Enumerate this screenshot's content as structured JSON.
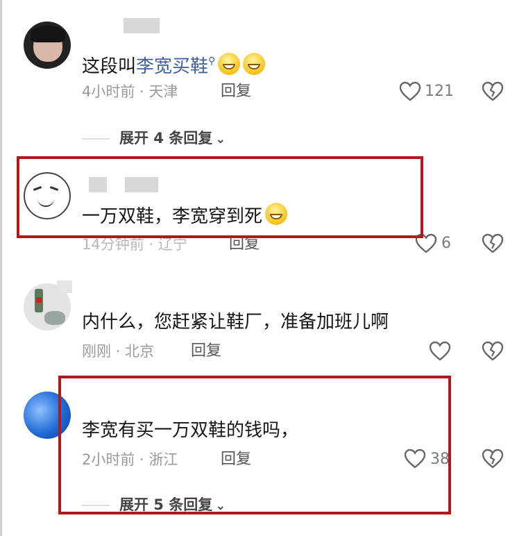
{
  "comments": [
    {
      "text_plain": "这段叫",
      "text_link": "李宽买鞋",
      "meta": "4小时前 · 天津",
      "reply_label": "回复",
      "likes": "121",
      "expand_label": "展开 4 条回复"
    },
    {
      "text": "一万双鞋，李宽穿到死",
      "meta": "14分钟前 · 辽宁",
      "reply_label": "回复",
      "likes": "6"
    },
    {
      "text": "内什么，您赶紧让鞋厂，准备加班儿啊",
      "meta": "刚刚 · 北京",
      "reply_label": "回复",
      "likes": ""
    },
    {
      "text": "李宽有买一万双鞋的钱吗，",
      "meta": "2小时前 · 浙江",
      "reply_label": "回复",
      "likes": "38",
      "expand_label": "展开 5 条回复"
    }
  ],
  "colors": {
    "highlight_border": "#b01a1a",
    "link": "#3f5f9c",
    "meta": "#9a9a9a"
  },
  "icons": [
    "heart-icon",
    "broken-heart-icon",
    "chevron-down-icon",
    "search-icon",
    "grin-emoji-icon"
  ]
}
